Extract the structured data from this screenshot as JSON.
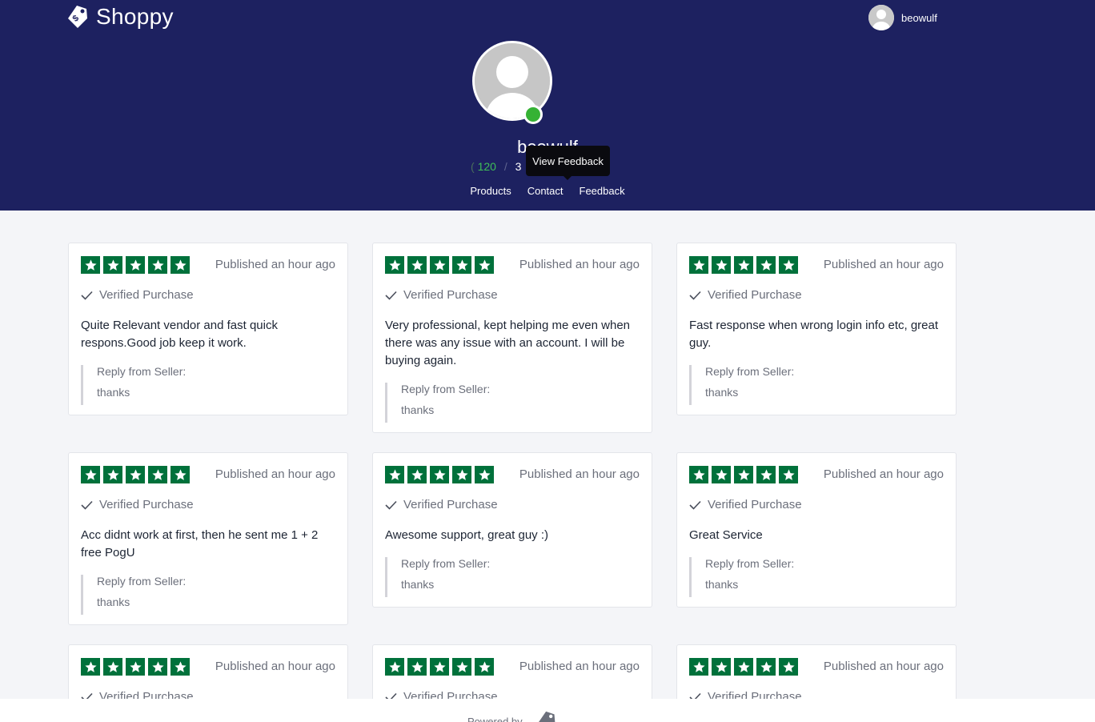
{
  "header": {
    "brand": "Shoppy",
    "brand_icon": "price-tag-icon",
    "user": "beowulf"
  },
  "profile": {
    "name": "beowulf",
    "feedback": {
      "open": "(",
      "positive": "120",
      "separator": "/",
      "neutral": "3"
    },
    "status": "online",
    "status_color": "#35b234",
    "tooltip": "View Feedback"
  },
  "nav": [
    "Products",
    "Contact",
    "Feedback"
  ],
  "colors": {
    "hero": "#1d2160",
    "star": "#00713b",
    "positive": "#3fbf58"
  },
  "reviews": [
    {
      "rating": 5,
      "published": "Published an hour ago",
      "verified": "Verified Purchase",
      "text": "Quite Relevant vendor and fast quick respons.Good job keep it work.",
      "reply_title": "Reply from Seller:",
      "reply": "thanks"
    },
    {
      "rating": 5,
      "published": "Published an hour ago",
      "verified": "Verified Purchase",
      "text": "Very professional, kept helping me even when there was any issue with an account. I will be buying again.",
      "reply_title": "Reply from Seller:",
      "reply": "thanks"
    },
    {
      "rating": 5,
      "published": "Published an hour ago",
      "verified": "Verified Purchase",
      "text": "Fast response when wrong login info etc, great guy.",
      "reply_title": "Reply from Seller:",
      "reply": "thanks"
    },
    {
      "rating": 5,
      "published": "Published an hour ago",
      "verified": "Verified Purchase",
      "text": "Acc didnt work at first, then he sent me 1 + 2 free PogU",
      "reply_title": "Reply from Seller:",
      "reply": "thanks"
    },
    {
      "rating": 5,
      "published": "Published an hour ago",
      "verified": "Verified Purchase",
      "text": "Awesome support, great guy :)",
      "reply_title": "Reply from Seller:",
      "reply": "thanks"
    },
    {
      "rating": 5,
      "published": "Published an hour ago",
      "verified": "Verified Purchase",
      "text": "Great Service",
      "reply_title": "Reply from Seller:",
      "reply": "thanks"
    },
    {
      "rating": 5,
      "published": "Published an hour ago",
      "verified": "Verified Purchase"
    },
    {
      "rating": 5,
      "published": "Published an hour ago",
      "verified": "Verified Purchase"
    },
    {
      "rating": 5,
      "published": "Published an hour ago",
      "verified": "Verified Purchase"
    }
  ],
  "footer": {
    "powered_by": "Powered by"
  }
}
